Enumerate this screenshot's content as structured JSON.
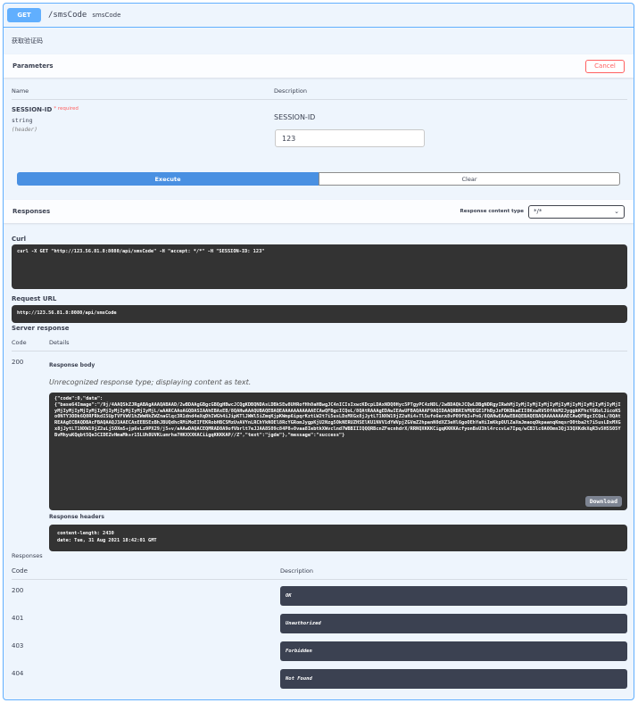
{
  "operation": {
    "method": "GET",
    "path": "/smsCode",
    "path_description": "smsCode",
    "description": "获取验证码"
  },
  "parameters": {
    "title": "Parameters",
    "cancel_label": "Cancel",
    "col_name": "Name",
    "col_description": "Description",
    "items": [
      {
        "name": "SESSION-ID",
        "required_label": "* required",
        "type": "string",
        "location": "(header)",
        "description": "SESSION-ID",
        "value": "123"
      }
    ]
  },
  "actions": {
    "execute_label": "Execute",
    "clear_label": "Clear"
  },
  "responses_header": {
    "title": "Responses",
    "content_type_label": "Response content type",
    "content_type_value": "*/*"
  },
  "curl": {
    "label": "Curl",
    "command": "curl -X GET \"http://123.56.81.8:8080/api/smsCode\" -H \"accept: */*\" -H \"SESSION-ID: 123\""
  },
  "request_url": {
    "label": "Request URL",
    "value": "http://123.56.81.8:8080/api/smsCode"
  },
  "server_response": {
    "label": "Server response",
    "col_code": "Code",
    "col_details": "Details",
    "code": "200",
    "body_label": "Response body",
    "unrecognized_note": "Unrecognized response type; displaying content as text.",
    "body": "{\"code\":0,\"data\":\n{\"base64Image\":\"/9j/4AAQSkZJRgABAgAAAQABAAD/2wBDAAgGBgcGBQgHBwcJCQgKDBQNDAsLDBkSEw8UHRofHh0aHBwgJC4nICIsIxwcKDcpLDAxNDQ0Hyc5PTgyPC4zNDL/2wBDAQkJCQwLDBgNDRgyIRwhMjIyMjIyMjIyMjIyMjIyMjIyMjIyMjIyMjIyMjIyMjIyMjIyMjIyMjIyMjIyMjIyMjIyMjIyMjL/wAARCAAoAGQDASIAAhEBAxEB/8QAHwAAAQUBAQEBAQEAAAAAAAAAAAECAwQFBgcICQoL/8QAtRAAAgEDAwIEAwUFBAQAAAF9AQIDAAQRBRIhMUEGE1FhByJxFDKBkaEII0KxwRVS0fAkM2JyggkKFhcYGRolJicoKSo0NTY3ODk6Q0RFRkdISUpTVFVWV1hZWmNkZWZnaGlqc3R1dnd4eXqDhIWGh4iJipKTlJWWl5iZmqKjpKWmp6ipqrKztLW2t7i5usLDxMXGx8jJytLT1NXW19jZ2uHi4+Tl5ufo6erx8vP09fb3+Pn6/8QAHwEAAwEBAQEBAQEBAQAAAAAAAAECAwQFBgcICQoL/8QAtREAAgECBAQDBAcFBAQAAQJ3AAECAxEEBSExBhJBUQdhcRMiMoEIFEKRobHBCSMzUvAVYnLRChYkNOEl8RcYGRomJygpKjU2Nzg5OkNERUZHSElKU1NVV1dYWVpjZGVmZ2hpanN0dXZ3eHl6goOEhYaHiImKkpOUlZaXmJmaoqOkpaanqKmqsrO0tba2t7i5usLDxMXGx8jJytLT1NXW19jZ2uLj5OXm5+jp6vLz9PX29/j5+v/aAAwDAQACEQMRAD8A9ofVbrlt7eJJAA8S09c84P8+0vaa8IebtkXWvclnd7WBBIIIQQQRBcnZFecnhdrX/RRNQXKKKCigqKKKKAcfyonBsU3hl4rccvLe7Ipq/wCB3lc0A0Omn3Qj33QXKdkXqR3v5H5S05YBvMhyuKQqbt5Qe3CIDEZvHmaMk+r15LUh8UVKLumrha7HKXXXKACiigqKKKKAP//Z\",\"text\":\"jgde\"},\"message\":\"success\"}",
    "download_label": "Download",
    "headers_label": "Response headers",
    "headers": [
      "content-length: 2430",
      "date: Tue, 31 Aug 2021 18:42:01 GMT"
    ]
  },
  "responses": {
    "title": "Responses",
    "col_code": "Code",
    "col_description": "Description",
    "items": [
      {
        "code": "200",
        "description": "OK"
      },
      {
        "code": "401",
        "description": "Unauthorized"
      },
      {
        "code": "403",
        "description": "Forbidden"
      },
      {
        "code": "404",
        "description": "Not Found"
      }
    ]
  },
  "colors": {
    "get_blue": "#61affe",
    "execute_blue": "#4990e2",
    "cancel_red": "#ff6060",
    "dark_block": "#333333"
  }
}
